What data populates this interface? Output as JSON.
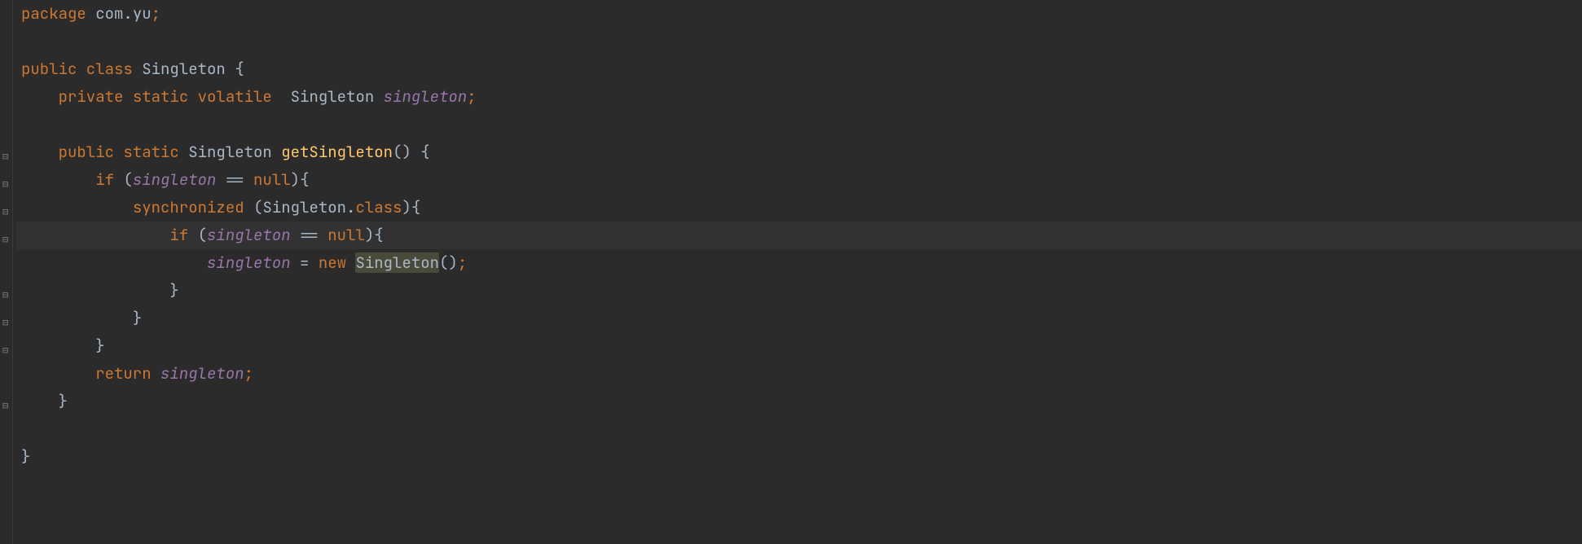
{
  "code": {
    "line1": {
      "kw": "package",
      "pkg": " com.yu",
      "semi": ";"
    },
    "line3": {
      "pub": "public",
      "cls": " class",
      "name": " Singleton ",
      "brace": "{"
    },
    "line4": {
      "indent": "    ",
      "priv": "private",
      "stat": " static",
      "vol": " volatile",
      "sp": "  ",
      "type": "Singleton ",
      "field": "singleton",
      "semi": ";"
    },
    "line6": {
      "indent": "    ",
      "pub": "public",
      "stat": " static",
      "type": " Singleton ",
      "method": "getSingleton",
      "parens": "() ",
      "brace": "{"
    },
    "line7": {
      "indent": "        ",
      "if": "if",
      "sp": " ",
      "lp": "(",
      "field": "singleton",
      "op": " == ",
      "null": "null",
      "rp": ")",
      "brace": "{"
    },
    "line8": {
      "indent": "            ",
      "sync": "synchronized",
      "sp": " ",
      "lp": "(",
      "cls": "Singleton",
      "dot": ".",
      "clskw": "class",
      "rp": ")",
      "brace": "{"
    },
    "line9": {
      "indent": "                ",
      "if": "if",
      "sp": " ",
      "lp": "(",
      "field": "singleton",
      "op": " == ",
      "null": "null",
      "rp": ")",
      "brace": "{"
    },
    "line10": {
      "indent": "                    ",
      "field": "singleton",
      "eq": " = ",
      "new": "new",
      "sp": " ",
      "cls": "Singleton",
      "parens": "()",
      "semi": ";"
    },
    "line11": {
      "indent": "                ",
      "brace": "}"
    },
    "line12": {
      "indent": "            ",
      "brace": "}"
    },
    "line13": {
      "indent": "        ",
      "brace": "}"
    },
    "line14": {
      "indent": "        ",
      "ret": "return",
      "sp": " ",
      "field": "singleton",
      "semi": ";"
    },
    "line15": {
      "indent": "    ",
      "brace": "}"
    },
    "line17": {
      "brace": "}"
    }
  }
}
